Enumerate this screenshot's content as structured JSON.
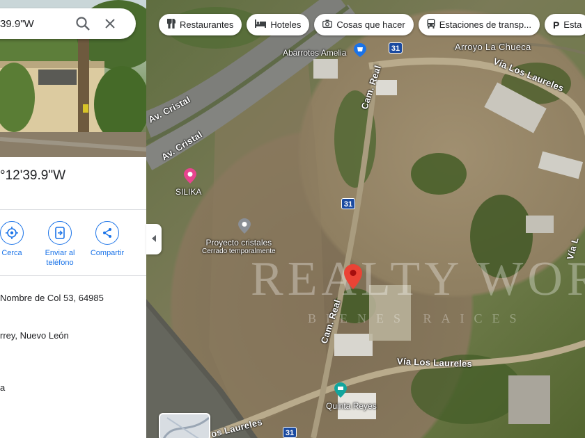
{
  "search": {
    "query": "39.9\"W"
  },
  "place": {
    "coords_title": "°12'39.9\"W"
  },
  "actions": [
    {
      "label": "Cerca"
    },
    {
      "label": "Enviar al\nteléfono"
    },
    {
      "label": "Compartir"
    }
  ],
  "info": {
    "address": "Nombre de Col 53, 64985",
    "city": "rrey, Nuevo León",
    "extra": "a"
  },
  "chips": [
    {
      "label": "Restaurantes",
      "icon": "fork-knife-icon"
    },
    {
      "label": "Hoteles",
      "icon": "bed-icon"
    },
    {
      "label": "Cosas que hacer",
      "icon": "camera-icon"
    },
    {
      "label": "Estaciones de transp...",
      "icon": "bus-icon"
    },
    {
      "label": "Esta",
      "icon": "parking-icon"
    }
  ],
  "map": {
    "roads": {
      "av_cristal_1": "Av. Cristal",
      "av_cristal_2": "Av. Cristal",
      "cam_real_1": "Cam. Real",
      "cam_real_2": "Cam. Real",
      "via_laureles_1": "Vía Los Laureles",
      "via_laureles_2": "Vía Los Laureles",
      "via_laureles_3": "os Laureles",
      "via_right": "Vía L",
      "arroyo": "Arroyo La Chueca"
    },
    "shields": [
      "31",
      "31",
      "31"
    ],
    "pois": {
      "abarrotes": "Abarrotes Amelia",
      "silika": "SILIKA",
      "proyecto": "Proyecto cristales",
      "proyecto_sub": "Cerrado temporalmente",
      "quinta": "Quinta Reyes"
    },
    "watermark": "REALTY WORLD",
    "watermark_sub": "BIENES RAICES"
  },
  "colors": {
    "accent": "#1a73e8",
    "pin": "#ea4335",
    "shield": "#1a4aa0"
  }
}
